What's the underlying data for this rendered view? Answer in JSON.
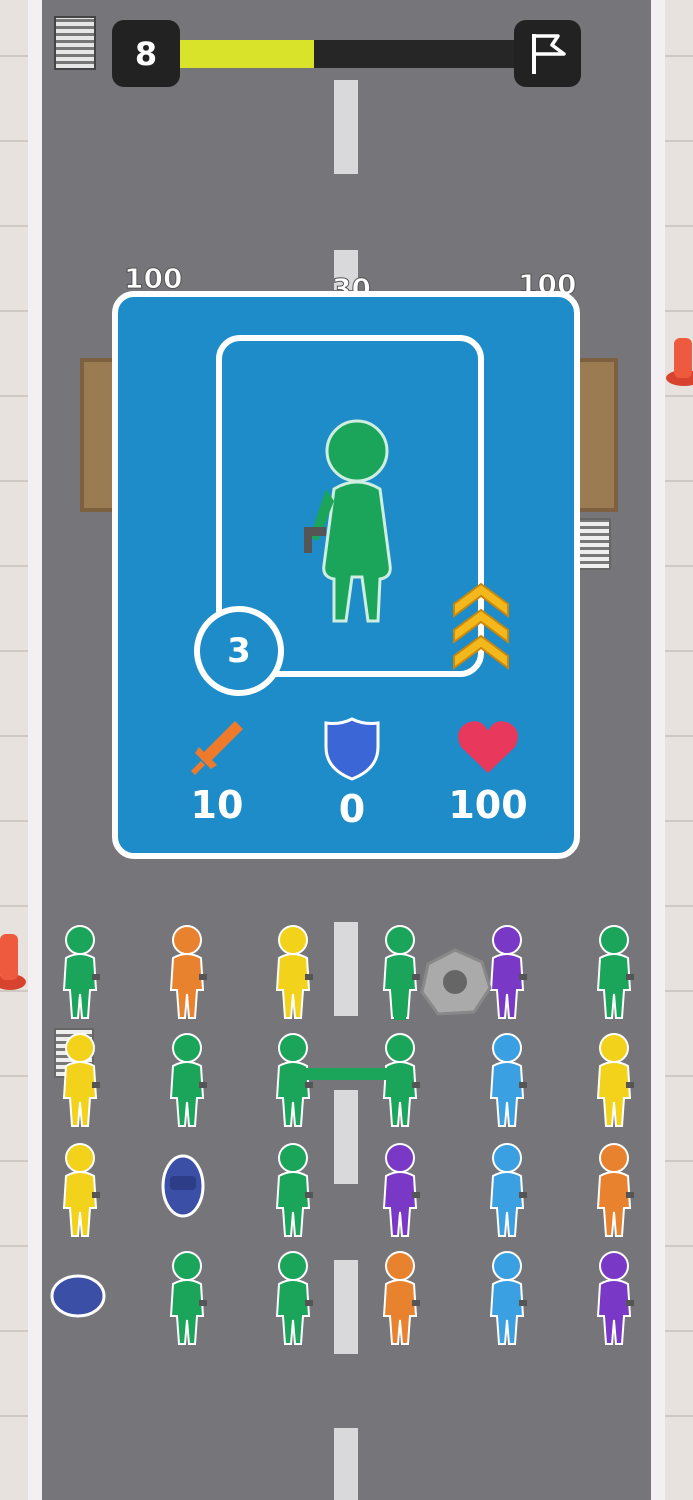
{
  "hud": {
    "level": "8",
    "progress": 0.4
  },
  "world_labels": {
    "left_gate": "100",
    "center_gate": "30",
    "right_gate": "100"
  },
  "unit_card": {
    "level": "3",
    "rank_chevrons": 3,
    "stats": {
      "attack": "10",
      "defense": "0",
      "health": "100"
    }
  },
  "colors": {
    "road": "#767579",
    "card": "#1d8cc9",
    "progress": "#d9e32a",
    "sword": "#f07a2c",
    "shield": "#3a66d6",
    "heart": "#e8385b",
    "chevrons": "#f2b81c"
  },
  "icons": [
    "pause-icon",
    "finish-flag-icon",
    "sword-icon",
    "shield-icon",
    "heart-icon",
    "rank-chevron-icon",
    "pistol-icon",
    "police-hat-icon"
  ]
}
